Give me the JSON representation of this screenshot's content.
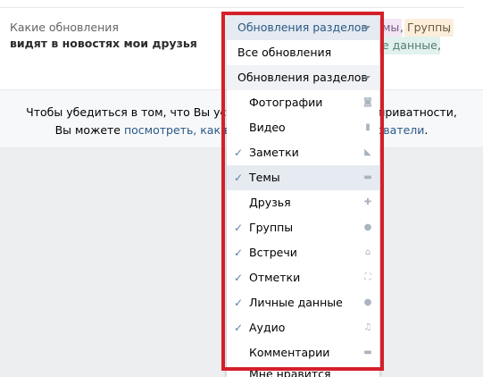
{
  "setting": {
    "label_line1": "Какие обновления",
    "label_line2": "видят в новостях мои друзья"
  },
  "tags": {
    "topics": "мы",
    "groups": "Группы",
    "personal": "е данные",
    "comma": ","
  },
  "info": {
    "line1": "Чтобы убедиться в том, что Вы устано",
    "line1_end": "приватности,",
    "line2_start": "Вы можете ",
    "link": "посмотреть, как видя",
    "link_end": "ователи",
    "line2_end": "."
  },
  "dropdown": {
    "selected": "Обновления разделов",
    "all_updates": "Все обновления",
    "section_updates": "Обновления разделов",
    "items": [
      {
        "label": "Фотографии",
        "checked": false,
        "icon": "camera-icon"
      },
      {
        "label": "Видео",
        "checked": false,
        "icon": "film-icon"
      },
      {
        "label": "Заметки",
        "checked": true,
        "icon": "note-icon"
      },
      {
        "label": "Темы",
        "checked": true,
        "icon": "speech-bubble-icon"
      },
      {
        "label": "Друзья",
        "checked": false,
        "icon": "plus-icon"
      },
      {
        "label": "Группы",
        "checked": true,
        "icon": "people-icon"
      },
      {
        "label": "Встречи",
        "checked": true,
        "icon": "house-icon"
      },
      {
        "label": "Отметки",
        "checked": true,
        "icon": "frame-icon"
      },
      {
        "label": "Личные данные",
        "checked": true,
        "icon": "person-icon"
      },
      {
        "label": "Аудио",
        "checked": true,
        "icon": "music-note-icon"
      },
      {
        "label": "Комментарии",
        "checked": false,
        "icon": "comment-icon"
      }
    ],
    "cut_item": "Мне нравится",
    "check_glyph": "✓"
  },
  "colors": {
    "highlight_frame": "#d42029",
    "link": "#2a5885"
  }
}
